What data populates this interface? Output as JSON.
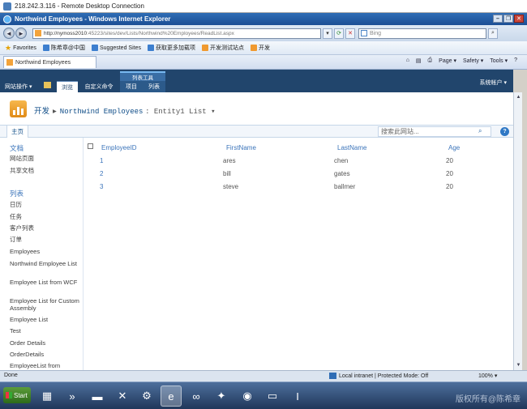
{
  "rdp": {
    "title": "218.242.3.116 - Remote Desktop Connection"
  },
  "browser": {
    "title": "Northwind Employees - Windows Internet Explorer",
    "window_buttons": [
      "–",
      "❐",
      "✕"
    ],
    "back_glyph": "◄",
    "forward_glyph": "►",
    "url_host": "http://nymoss2010",
    "url_path": ":45223/sites/dev/Lists/Northwind%20Employees/ReadList.aspx",
    "search_placeholder": "Bing",
    "favorites_label": "Favorites",
    "favorites_items": [
      "陈希章@中国",
      "Suggested Sites",
      "获取更多加载项",
      "开发测试站点",
      "开发"
    ],
    "tab_title": "Northwind Employees",
    "tools_items": [
      "Page ▾",
      "Safety ▾",
      "Tools ▾"
    ]
  },
  "sharepoint": {
    "site_actions": "网站操作 ▾",
    "tabs": [
      "浏览",
      "自定义命令",
      "项目",
      "列表"
    ],
    "context_group": "列表工具",
    "account": "系统帐户 ▾",
    "breadcrumb": {
      "site": "开发",
      "list": "Northwind Employees",
      "view": ": Entity1 List ▾"
    },
    "home_tab": "主页",
    "search_placeholder": "搜索此网站...",
    "help_glyph": "?",
    "quicklaunch": {
      "documents_heading": "文档",
      "documents_items": [
        "网站页面",
        "共享文档"
      ],
      "lists_heading": "列表",
      "lists_items": [
        "日历",
        "任务",
        "客户列表",
        "订单",
        "Employees",
        "Northwind Employee List",
        "Employee List from WCF",
        "Employee List for Custom Assembly",
        "Employee List",
        "Test",
        "Order Details",
        "OrderDetails",
        "EmployeeList from"
      ]
    },
    "table": {
      "columns": [
        "EmployeeID",
        "FirstName",
        "LastName",
        "Age"
      ],
      "rows": [
        [
          "1",
          "ares",
          "chen",
          "20"
        ],
        [
          "2",
          "bill",
          "gates",
          "20"
        ],
        [
          "3",
          "steve",
          "ballmer",
          "20"
        ]
      ]
    }
  },
  "status": {
    "left": "Done",
    "zone": "Local intranet | Protected Mode: Off",
    "zoom": "100% ▾"
  },
  "taskbar": {
    "start_label": "Start",
    "watermark": "版权所有@陈希章"
  }
}
